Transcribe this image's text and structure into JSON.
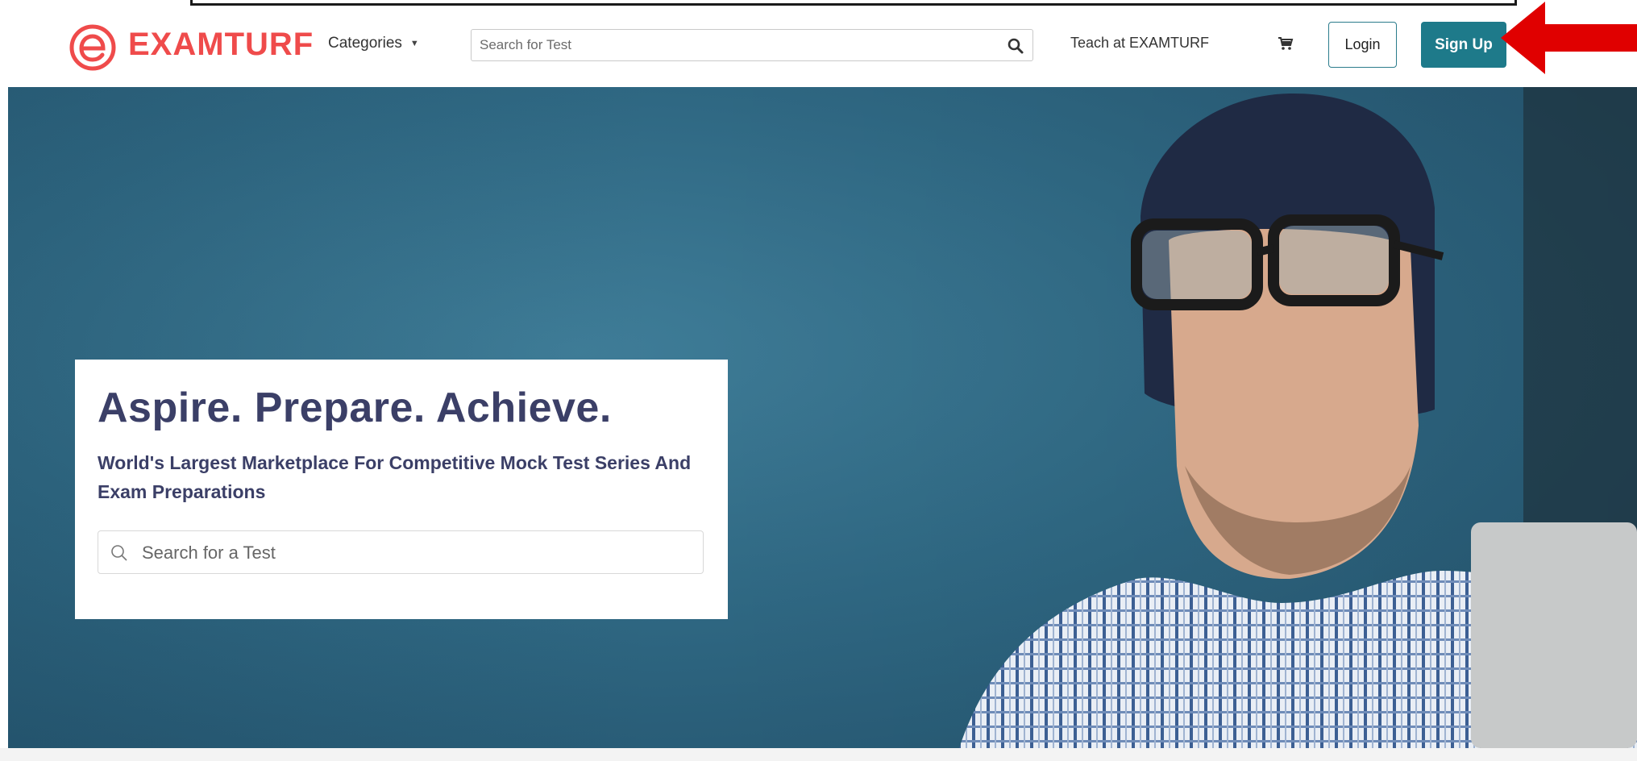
{
  "brand": {
    "name": "EXAMTURF",
    "color": "#ef4b4b"
  },
  "nav": {
    "categories_label": "Categories",
    "search_placeholder": "Search for Test",
    "teach_label": "Teach at EXAMTURF",
    "login_label": "Login",
    "signup_label": "Sign Up"
  },
  "hero": {
    "title": "Aspire. Prepare. Achieve.",
    "subtitle": "World's Largest Marketplace For Competitive Mock Test Series And Exam Preparations",
    "search_placeholder": "Search for a Test"
  },
  "colors": {
    "accent": "#1e7a8a",
    "heading": "#3b3f67",
    "annotation_arrow": "#e00000",
    "hero_bg": "#2f6883"
  },
  "icons": {
    "logo": "examturf-logo-icon",
    "search": "search-icon",
    "cart": "cart-icon",
    "caret": "caret-down-icon",
    "arrow": "red-pointer-arrow-icon"
  }
}
